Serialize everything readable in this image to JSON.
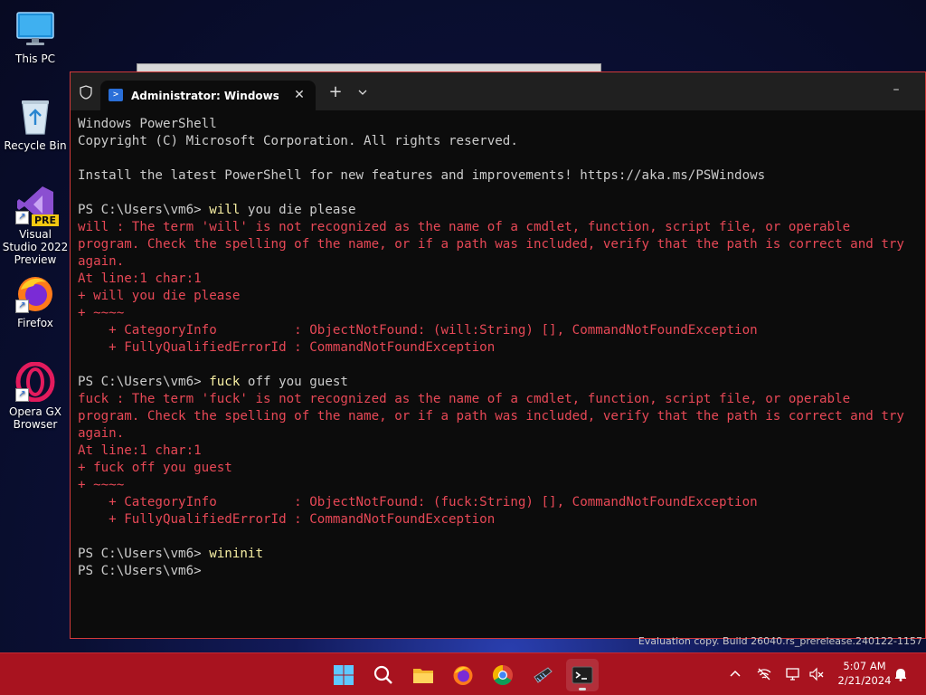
{
  "desktop": {
    "icons": [
      {
        "label": "This PC",
        "icon": "monitor-icon"
      },
      {
        "label": "Recycle Bin",
        "icon": "recycle-bin-icon"
      },
      {
        "label": "Visual Studio 2022 Preview",
        "badge": "PRE",
        "icon": "visual-studio-icon"
      },
      {
        "label": "Firefox",
        "icon": "firefox-icon"
      },
      {
        "label": "Opera GX Browser",
        "icon": "opera-gx-icon"
      }
    ],
    "watermark": "Evaluation copy. Build 26040.rs_prerelease.240122-1157"
  },
  "terminal": {
    "tab_title": "Administrator: Windows PowerShell",
    "new_tab_label": "+",
    "close_label": "✕",
    "minimize_label": "–",
    "lines": [
      {
        "text": "Windows PowerShell",
        "style": "out"
      },
      {
        "text": "Copyright (C) Microsoft Corporation. All rights reserved.",
        "style": "out"
      },
      {
        "text": "",
        "style": "out"
      },
      {
        "text": "Install the latest PowerShell for new features and improvements! https://aka.ms/PSWindows",
        "style": "out"
      },
      {
        "text": "",
        "style": "out"
      },
      {
        "prompt": "PS C:\\Users\\vm6> ",
        "cmd": "will",
        "args": " you die please",
        "style": "prompt"
      },
      {
        "text": "will : The term 'will' is not recognized as the name of a cmdlet, function, script file, or operable",
        "style": "err"
      },
      {
        "text": "program. Check the spelling of the name, or if a path was included, verify that the path is correct and try",
        "style": "err"
      },
      {
        "text": "again.",
        "style": "err"
      },
      {
        "text": "At line:1 char:1",
        "style": "err"
      },
      {
        "text": "+ will you die please",
        "style": "err"
      },
      {
        "text": "+ ~~~~",
        "style": "err"
      },
      {
        "text": "    + CategoryInfo          : ObjectNotFound: (will:String) [], CommandNotFoundException",
        "style": "err"
      },
      {
        "text": "    + FullyQualifiedErrorId : CommandNotFoundException",
        "style": "err"
      },
      {
        "text": "",
        "style": "out"
      },
      {
        "prompt": "PS C:\\Users\\vm6> ",
        "cmd": "fuck",
        "args": " off you guest",
        "style": "prompt"
      },
      {
        "text": "fuck : The term 'fuck' is not recognized as the name of a cmdlet, function, script file, or operable",
        "style": "err"
      },
      {
        "text": "program. Check the spelling of the name, or if a path was included, verify that the path is correct and try",
        "style": "err"
      },
      {
        "text": "again.",
        "style": "err"
      },
      {
        "text": "At line:1 char:1",
        "style": "err"
      },
      {
        "text": "+ fuck off you guest",
        "style": "err"
      },
      {
        "text": "+ ~~~~",
        "style": "err"
      },
      {
        "text": "    + CategoryInfo          : ObjectNotFound: (fuck:String) [], CommandNotFoundException",
        "style": "err"
      },
      {
        "text": "    + FullyQualifiedErrorId : CommandNotFoundException",
        "style": "err"
      },
      {
        "text": "",
        "style": "out"
      },
      {
        "prompt": "PS C:\\Users\\vm6> ",
        "cmd": "wininit",
        "args": "",
        "style": "prompt"
      },
      {
        "prompt": "PS C:\\Users\\vm6>",
        "cmd": "",
        "args": "",
        "style": "prompt"
      }
    ]
  },
  "taskbar": {
    "apps": [
      "start-icon",
      "search-icon",
      "file-explorer-icon",
      "firefox-icon",
      "chrome-icon",
      "tools-icon",
      "terminal-icon"
    ],
    "tray": [
      "chevron-up-icon",
      "network-off-icon",
      "display-icon",
      "volume-muted-icon"
    ],
    "time": "5:07 AM",
    "date": "2/21/2024",
    "notification_icon": "bell-icon"
  },
  "colors": {
    "taskbar": "#a8131f",
    "terminal_bg": "#0c0c0c",
    "error_text": "#e74856",
    "command_text": "#f9f1a5"
  }
}
